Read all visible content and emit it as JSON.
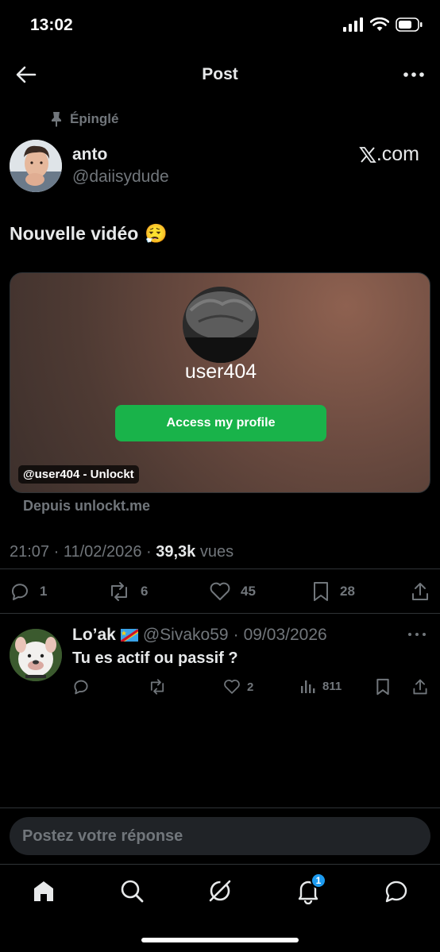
{
  "status_bar": {
    "time": "13:02"
  },
  "header": {
    "title": "Post"
  },
  "post": {
    "pinned_label": "Épinglé",
    "author_name": "anto",
    "author_handle": "@daiisydude",
    "domain": ".com",
    "text": "Nouvelle vidéo",
    "emoji": "😮‍💨",
    "card": {
      "username": "user404",
      "button_label": "Access my profile",
      "tag": "@user404 - Unlockt",
      "source": "Depuis unlockt.me"
    },
    "time": "21:07",
    "date": "11/02/2026",
    "views_count": "39,3k",
    "views_label": "vues",
    "stats": {
      "replies": "1",
      "reposts": "6",
      "likes": "45",
      "bookmarks": "28"
    }
  },
  "reply": {
    "name": "Lo’ak",
    "handle": "@Sivako59",
    "date": "09/03/2026",
    "text": "Tu es actif ou passif ?",
    "stats": {
      "likes": "2",
      "views": "811"
    }
  },
  "composer": {
    "placeholder": "Postez votre réponse"
  },
  "tabbar": {
    "notifications_badge": "1"
  },
  "colors": {
    "background": "#000000",
    "accent": "#1d9bf0",
    "card_button": "#19b34a",
    "muted": "#71767b"
  }
}
